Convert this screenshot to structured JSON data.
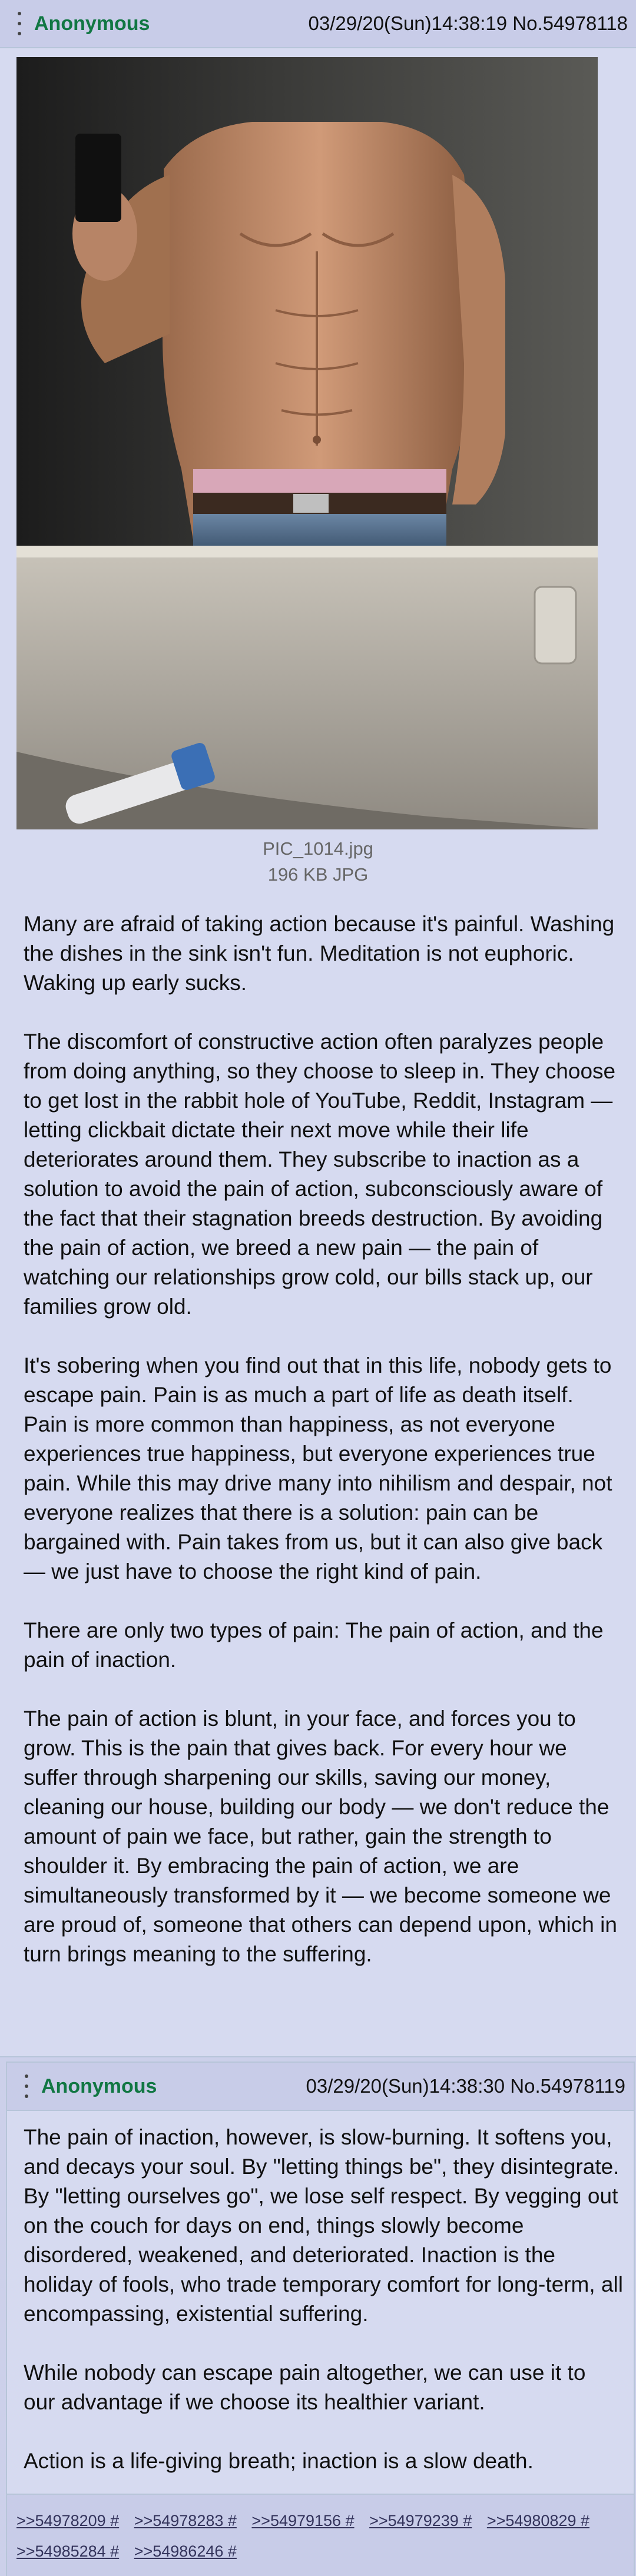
{
  "post1": {
    "name": "Anonymous",
    "datetime": "03/29/20(Sun)14:38:19",
    "number": "No.54978118",
    "file": {
      "filename": "PIC_1014.jpg",
      "size": "196 KB JPG"
    },
    "paragraphs": [
      "Many are afraid of taking action because it's painful. Washing the dishes in the sink isn't fun. Meditation is not euphoric. Waking up early sucks.",
      "The discomfort of constructive action often paralyzes people from doing anything, so they choose to sleep in. They choose to get lost in the rabbit hole of YouTube, Reddit, Instagram — letting clickbait dictate their next move while their life deteriorates around them. They subscribe to inaction as a solution to avoid the pain of action, subconsciously aware of the fact that their stagnation breeds destruction. By avoiding the pain of action, we breed a new pain — the pain of watching our relationships grow cold, our bills stack up, our families grow old.",
      "It's sobering when you find out that in this life, nobody gets to escape pain. Pain is as much a part of life as death itself. Pain is more common than happiness, as not everyone experiences true happiness, but everyone experiences true pain. While this may drive many into nihilism and despair, not everyone realizes that there is a solution: pain can be bargained with. Pain takes from us, but it can also give back — we just have to choose the right kind of pain.",
      "There are only two types of pain: The pain of action, and the pain of inaction.",
      "The pain of action is blunt, in your face, and forces you to grow. This is the pain that gives back. For every hour we suffer through sharpening our skills, saving our money, cleaning our house, building our body — we don't reduce the amount of pain we face, but rather, gain the strength to shoulder it. By embracing the pain of action, we are simultaneously transformed by it — we become someone we are proud of, someone that others can depend upon, which in turn brings meaning to the suffering."
    ]
  },
  "post2": {
    "name": "Anonymous",
    "datetime": "03/29/20(Sun)14:38:30",
    "number": "No.54978119",
    "paragraphs": [
      "The pain of inaction, however, is slow-burning. It softens you, and decays your soul. By \"letting things be\", they disintegrate. By \"letting ourselves go\", we lose self respect. By vegging out on the couch for days on end, things slowly become disordered, weakened, and deteriorated. Inaction is the holiday of fools, who trade temporary comfort for long-term, all encompassing, existential suffering.",
      "While nobody can escape pain altogether, we can use it to our advantage if we choose its healthier variant.",
      "Action is a life-giving breath; inaction is a slow death."
    ],
    "replies": [
      ">>54978209 #",
      ">>54978283 #",
      ">>54979156 #",
      ">>54979239 #",
      ">>54980829 #",
      ">>54985284 #",
      ">>54986246 #"
    ]
  },
  "colors": {
    "post_bg": "#d6daf0",
    "header_bg": "#c8cce8",
    "name": "#117743",
    "reply_link": "#34345c"
  }
}
